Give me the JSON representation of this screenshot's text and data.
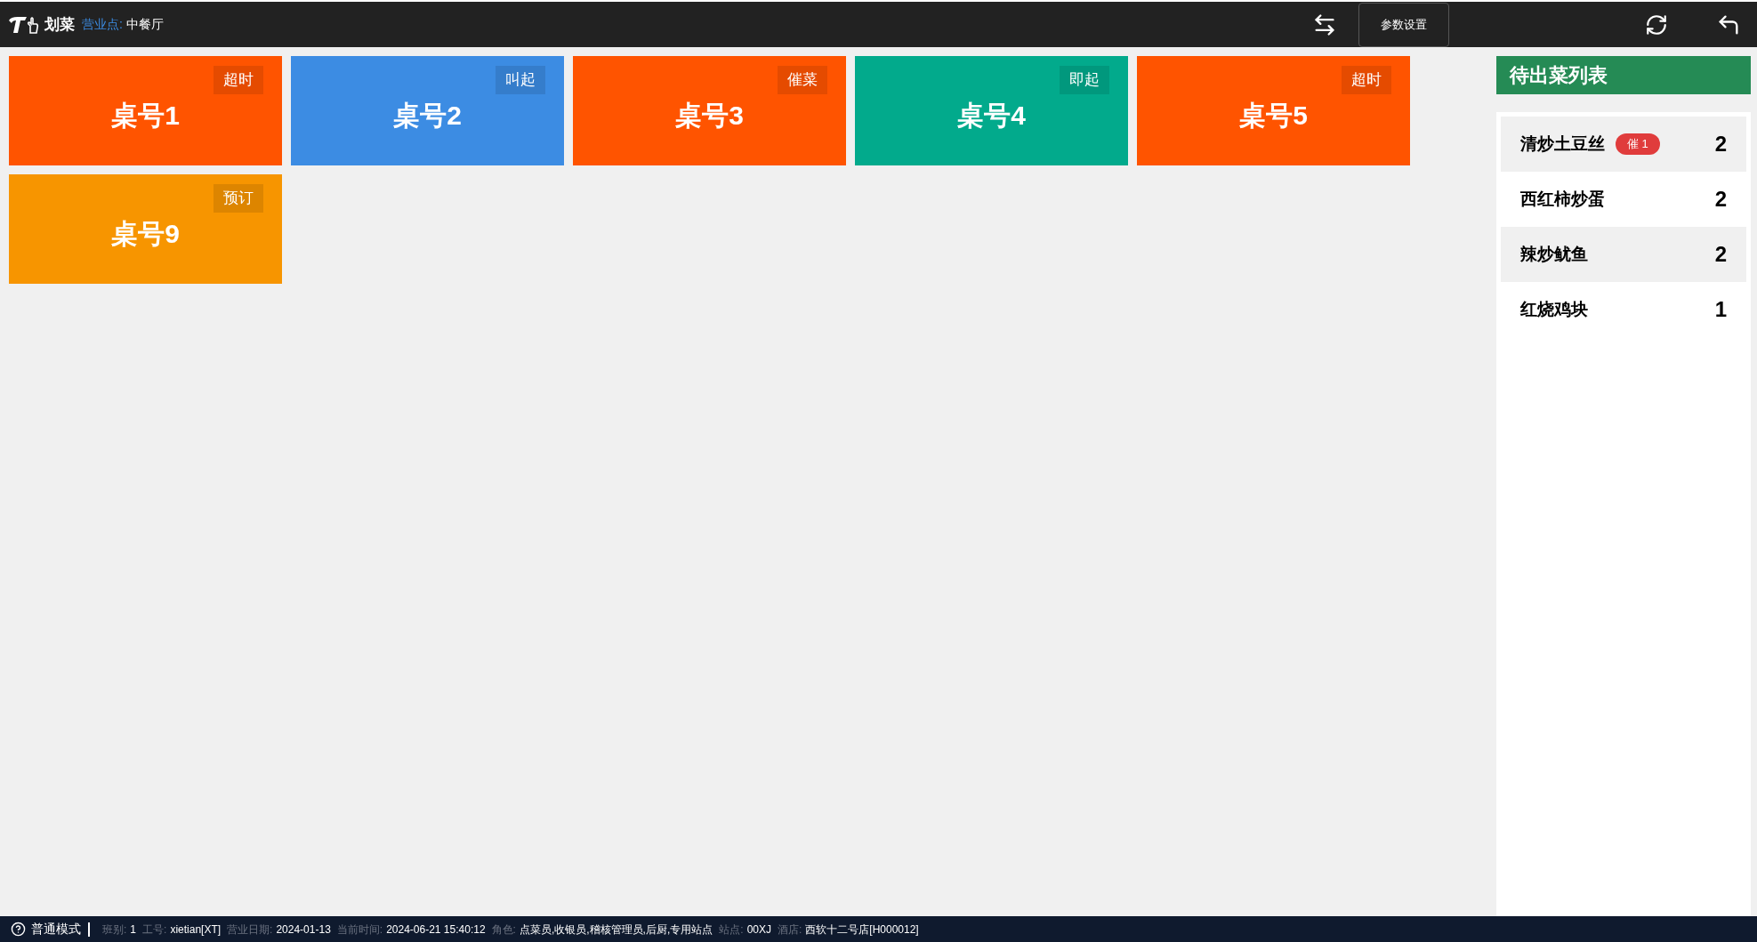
{
  "topbar": {
    "app_name": "划菜",
    "outlet_label": "营业点:",
    "outlet": "中餐厅",
    "settings_button": "参数设置"
  },
  "tables": [
    {
      "name": "桌号1",
      "status": "超时",
      "color": "#ff5400"
    },
    {
      "name": "桌号2",
      "status": "叫起",
      "color": "#3c8ce3"
    },
    {
      "name": "桌号3",
      "status": "催菜",
      "color": "#ff5400"
    },
    {
      "name": "桌号4",
      "status": "即起",
      "color": "#02aa8c"
    },
    {
      "name": "桌号5",
      "status": "超时",
      "color": "#ff5400"
    },
    {
      "name": "桌号9",
      "status": "预订",
      "color": "#f79500"
    }
  ],
  "pending": {
    "title": "待出菜列表",
    "items": [
      {
        "name": "清炒土豆丝",
        "badge": "催 1",
        "count": "2"
      },
      {
        "name": "西红柿炒蛋",
        "count": "2"
      },
      {
        "name": "辣炒鱿鱼",
        "count": "2"
      },
      {
        "name": "红烧鸡块",
        "count": "1"
      }
    ]
  },
  "status_bar": {
    "mode": "普通模式",
    "fields": [
      {
        "label": "班别:",
        "value": "1"
      },
      {
        "label": "工号:",
        "value": "xietian[XT]"
      },
      {
        "label": "营业日期:",
        "value": "2024-01-13"
      },
      {
        "label": "当前时间:",
        "value": "2024-06-21 15:40:12"
      },
      {
        "label": "角色:",
        "value": "点菜员,收银员,稽核管理员,后厨,专用站点"
      },
      {
        "label": "站点:",
        "value": "00XJ"
      },
      {
        "label": "酒店:",
        "value": "西软十二号店[H000012]"
      }
    ]
  }
}
